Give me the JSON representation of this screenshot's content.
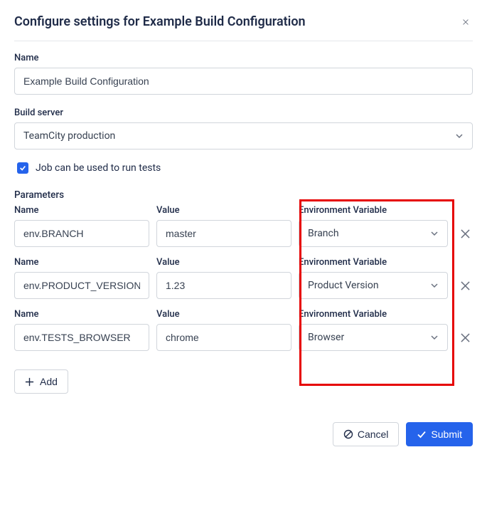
{
  "dialog": {
    "title": "Configure settings for Example Build Configuration"
  },
  "form": {
    "name_label": "Name",
    "name_value": "Example Build Configuration",
    "server_label": "Build server",
    "server_value": "TeamCity production",
    "tests_checkbox_label": "Job can be used to run tests",
    "tests_checkbox_checked": true
  },
  "parameters": {
    "section_title": "Parameters",
    "name_header": "Name",
    "value_header": "Value",
    "env_header": "Environment Variable",
    "rows": [
      {
        "name": "env.BRANCH",
        "value": "master",
        "env": "Branch"
      },
      {
        "name": "env.PRODUCT_VERSION",
        "value": "1.23",
        "env": "Product Version"
      },
      {
        "name": "env.TESTS_BROWSER",
        "value": "chrome",
        "env": "Browser"
      }
    ],
    "add_label": "Add"
  },
  "footer": {
    "cancel_label": "Cancel",
    "submit_label": "Submit"
  }
}
